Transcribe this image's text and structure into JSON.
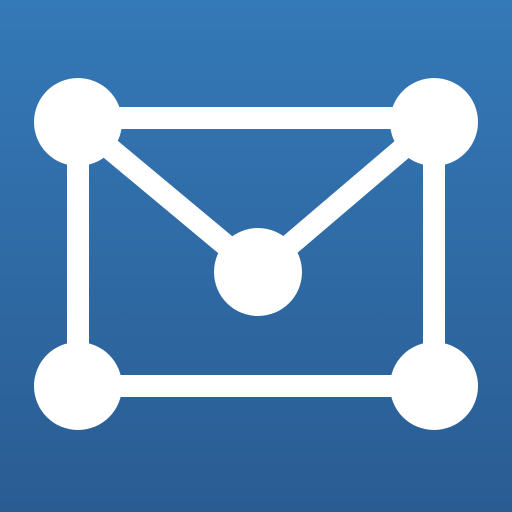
{
  "icon": {
    "semantic_name": "network-envelope-icon",
    "background_gradient": {
      "top": "#3479B8",
      "bottom": "#2A5C92"
    },
    "foreground_color": "#FFFFFF"
  }
}
